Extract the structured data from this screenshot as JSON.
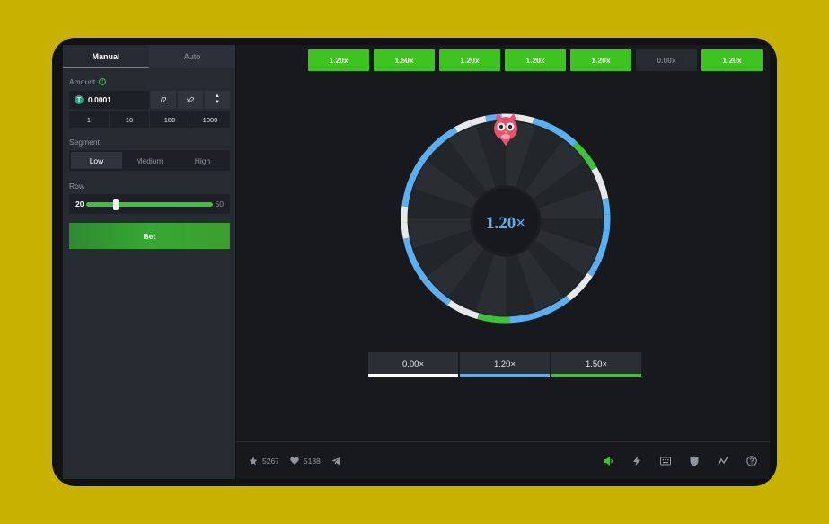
{
  "sidebar": {
    "tabs": [
      {
        "label": "Manual",
        "active": true
      },
      {
        "label": "Auto",
        "active": false
      }
    ],
    "amount": {
      "label": "Amount",
      "coin_symbol": "T",
      "value": "0.0001",
      "half_label": "/2",
      "double_label": "x2",
      "quick_values": [
        "1",
        "10",
        "100",
        "1000"
      ]
    },
    "segment": {
      "label": "Segment",
      "options": [
        "Low",
        "Medium",
        "High"
      ],
      "selected": "Low"
    },
    "row": {
      "label": "Row",
      "min": "20",
      "max": "50",
      "value": 20
    },
    "bet_label": "Bet"
  },
  "history": [
    "1.20x",
    "1.50x",
    "1.20x",
    "1.20x",
    "1.20x",
    "0.00x",
    "1.20x"
  ],
  "wheel": {
    "current_value": "1.20×",
    "segment_colors": [
      "white",
      "white",
      "blue",
      "blue",
      "blue",
      "green",
      "green",
      "white",
      "white",
      "blue",
      "blue",
      "blue",
      "blue",
      "blue",
      "white",
      "white",
      "blue",
      "blue",
      "blue",
      "blue",
      "green",
      "green",
      "white",
      "white",
      "blue",
      "blue",
      "blue",
      "blue",
      "blue",
      "white",
      "white",
      "blue",
      "blue",
      "blue",
      "blue",
      "blue",
      "blue",
      "white",
      "white",
      "blue"
    ]
  },
  "legend": [
    {
      "label": "0.00×",
      "color": "#ffffff"
    },
    {
      "label": "1.20×",
      "color": "#5ab0f0"
    },
    {
      "label": "1.50×",
      "color": "#3dc23a"
    }
  ],
  "footer": {
    "stars": "5267",
    "likes": "5138"
  },
  "colors": {
    "accent_green": "#3dc23a",
    "wheel_blue": "#5ab0f0",
    "background": "#c9b100"
  }
}
